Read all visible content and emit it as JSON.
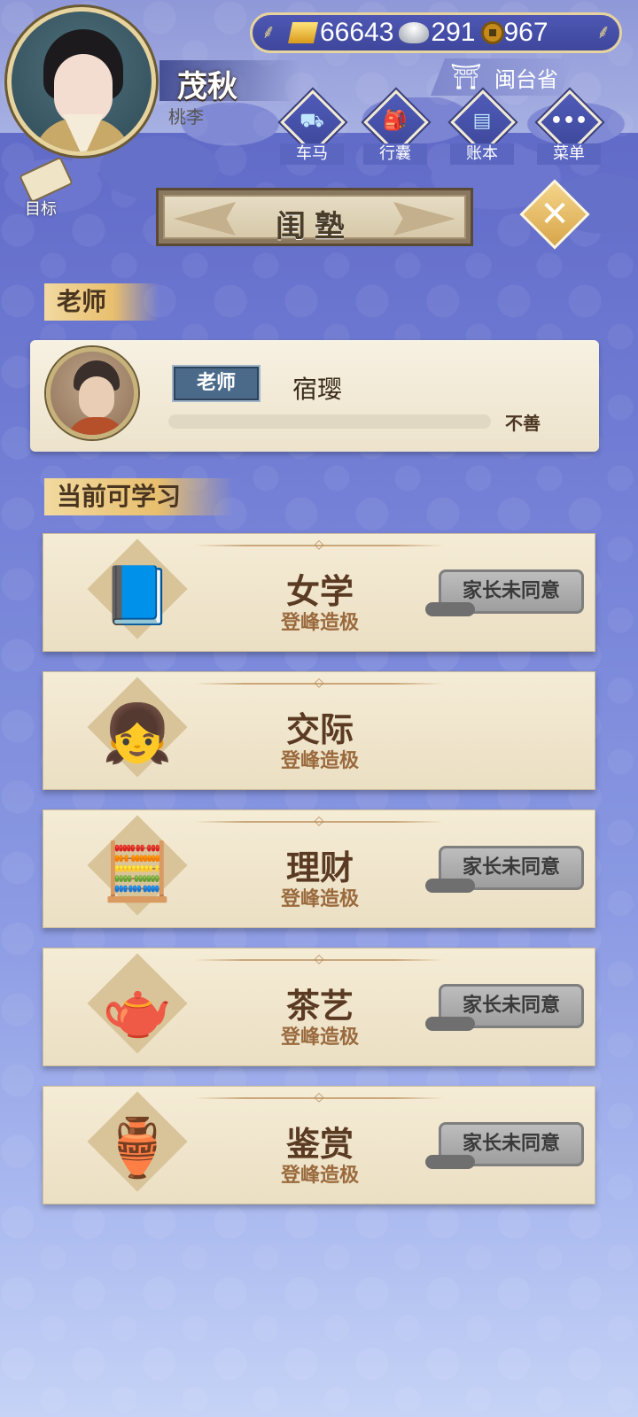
{
  "header": {
    "char_name": "茂秋",
    "char_title": "桃李",
    "currency": {
      "gold": "66643",
      "silver": "291",
      "coin": "967"
    },
    "province": "闽台省",
    "nav": [
      {
        "label": "车马",
        "icon": "carriage-icon"
      },
      {
        "label": "行囊",
        "icon": "bag-icon"
      },
      {
        "label": "账本",
        "icon": "ledger-icon"
      },
      {
        "label": "菜单",
        "icon": "menu-dots-icon"
      }
    ],
    "goal_label": "目标"
  },
  "page": {
    "title": "闺塾"
  },
  "teacher_section": {
    "header": "老师",
    "tag": "老师",
    "name": "宿璎",
    "affinity_label": "不善",
    "affinity_fill": 0.0
  },
  "courses_section": {
    "header": "当前可学习",
    "courses": [
      {
        "name": "女学",
        "level": "登峰造极",
        "button": "家长未同意",
        "icon": "book-icon"
      },
      {
        "name": "交际",
        "level": "登峰造极",
        "button": "",
        "icon": "chatting-girl-icon"
      },
      {
        "name": "理财",
        "level": "登峰造极",
        "button": "家长未同意",
        "icon": "abacus-icon"
      },
      {
        "name": "茶艺",
        "level": "登峰造极",
        "button": "家长未同意",
        "icon": "teapot-icon"
      },
      {
        "name": "鉴赏",
        "level": "登峰造极",
        "button": "家长未同意",
        "icon": "vase-icon"
      }
    ]
  },
  "colors": {
    "background": "#6772cd",
    "card": "#f5ecd6",
    "accent_gold": "#e8bf6e",
    "disabled_button": "#a8a8a8",
    "text_brown": "#5a3a22"
  }
}
